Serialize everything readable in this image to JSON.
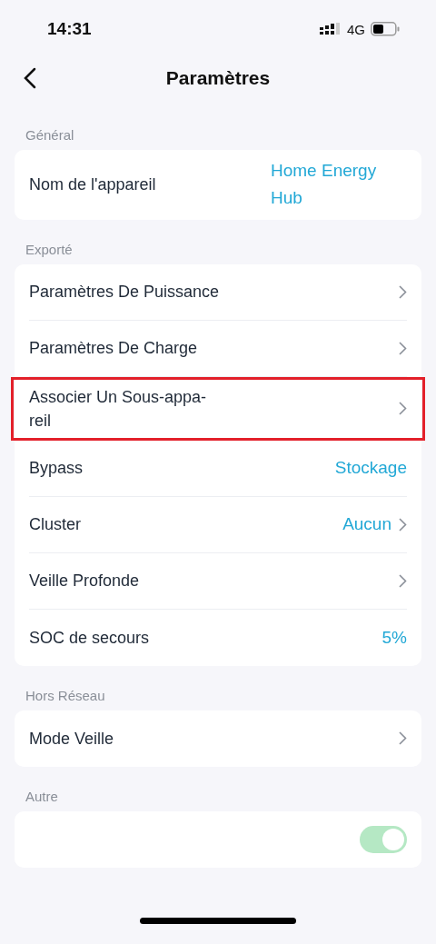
{
  "status_bar": {
    "time": "14:31",
    "network": "4G"
  },
  "header": {
    "title": "Paramètres"
  },
  "sections": [
    {
      "title": "Général",
      "rows": [
        {
          "label": "Nom de l'appareil",
          "value": "Home Energy Hub",
          "chevron": false,
          "highlighted": false
        }
      ]
    },
    {
      "title": "Exporté",
      "rows": [
        {
          "label": "Paramètres De Puissance",
          "chevron": true,
          "highlighted": false
        },
        {
          "label": "Paramètres De Charge",
          "chevron": true,
          "highlighted": false
        },
        {
          "label": "Associer Un Sous-appa-\nreil",
          "chevron": true,
          "highlighted": true
        },
        {
          "label": "Bypass",
          "value": "Stockage",
          "chevron": false,
          "highlighted": false
        },
        {
          "label": "Cluster",
          "value": "Aucun",
          "chevron": true,
          "highlighted": false
        },
        {
          "label": "Veille Profonde",
          "chevron": true,
          "highlighted": false
        },
        {
          "label": "SOC de secours",
          "value": "5%",
          "chevron": false,
          "highlighted": false
        }
      ]
    },
    {
      "title": "Hors Réseau",
      "rows": [
        {
          "label": "Mode Veille",
          "chevron": true,
          "highlighted": false
        }
      ]
    },
    {
      "title": "Autre",
      "rows": [
        {
          "kind": "toggle",
          "on": true
        }
      ]
    }
  ]
}
